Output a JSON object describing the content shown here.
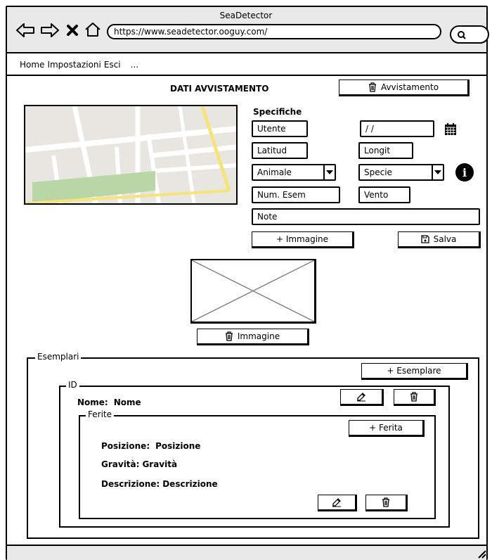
{
  "window": {
    "title": "SeaDetector"
  },
  "browser": {
    "url": "https://www.seadetector.ooguy.com/"
  },
  "menu": {
    "items": [
      "Home",
      "Impostazioni",
      "Esci",
      "..."
    ]
  },
  "form": {
    "header": "DATI AVVISTAMENTO",
    "delete_sighting_label": "Avvistamento",
    "specs_label": "Specifiche",
    "fields": {
      "utente": "Utente",
      "date": "/ /",
      "latitud": "Latitud",
      "longit": "Longit",
      "animale": "Animale",
      "specie": "Specie",
      "num_esem": "Num. Esem",
      "vento": "Vento",
      "note": "Note"
    },
    "add_image_label": "+ Immagine",
    "save_label": "Salva",
    "delete_image_label": "Immagine"
  },
  "esemplari": {
    "legend": "Esemplari",
    "add_label": "+ Esemplare",
    "item": {
      "legend": "ID",
      "name_label": "Nome:",
      "name_value": "Nome",
      "ferite": {
        "legend": "Ferite",
        "add_label": "+ Ferita",
        "posizione_label": "Posizione:",
        "posizione_value": "Posizione",
        "gravita_label": "Gravità:",
        "gravita_value": "Gravità",
        "descrizione_label": "Descrizione:",
        "descrizione_value": "Descrizione"
      }
    }
  },
  "colors": {
    "road_yellow": "#f6e37a",
    "park_green": "#b9d6a6",
    "map_bg": "#e8e6e1",
    "chrome_gray": "#e9e9e9"
  }
}
